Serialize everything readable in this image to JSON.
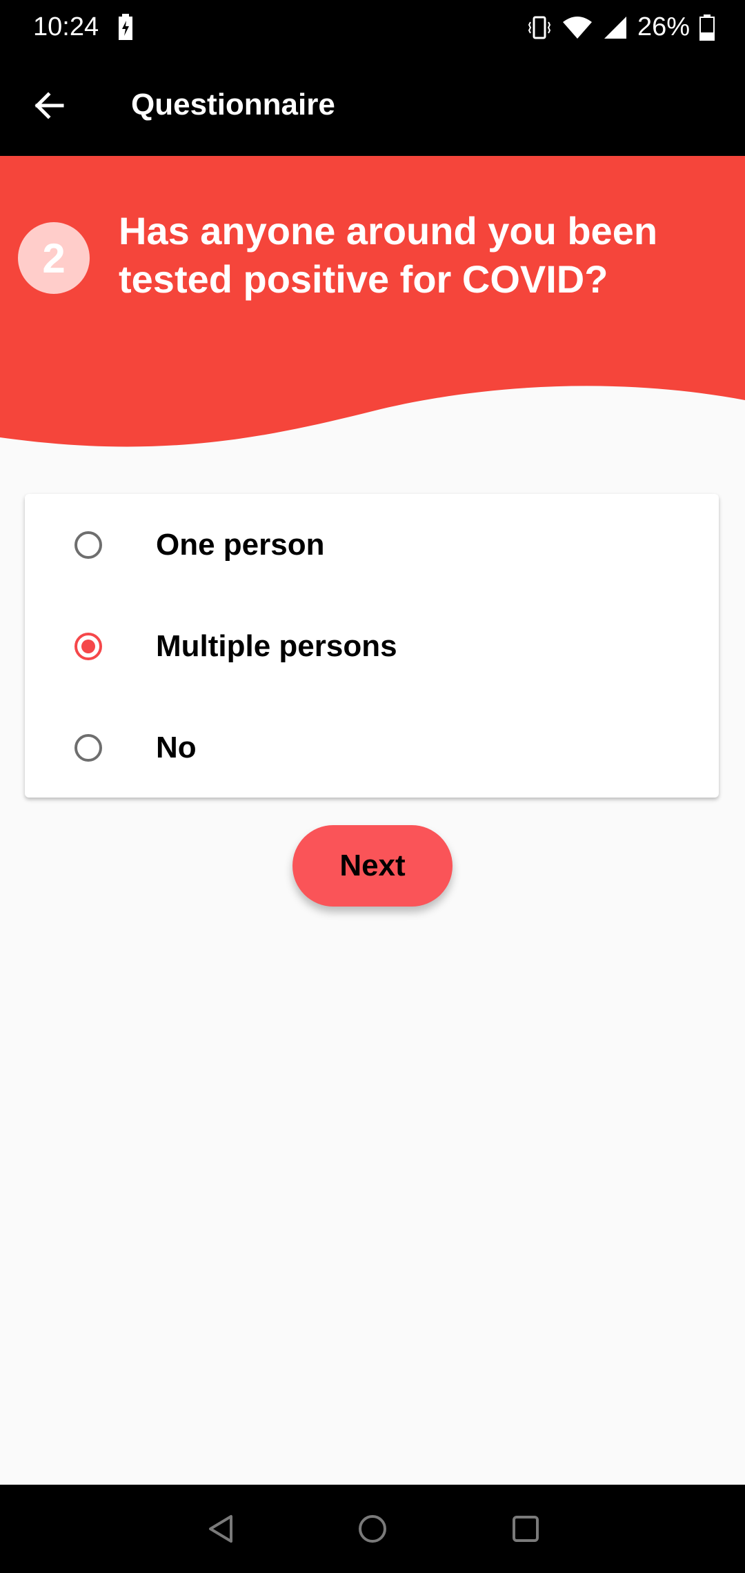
{
  "status_bar": {
    "time": "10:24",
    "battery_percent": "26%",
    "icons": [
      "battery-charging-icon",
      "vibrate-icon",
      "wifi-icon",
      "cell-signal-icon",
      "battery-icon"
    ]
  },
  "app_bar": {
    "title": "Questionnaire",
    "back_icon": "arrow-back-icon"
  },
  "question": {
    "number": "2",
    "text": "Has anyone around you been tested positive for COVID?"
  },
  "options": [
    {
      "label": "One person",
      "selected": false
    },
    {
      "label": "Multiple persons",
      "selected": true
    },
    {
      "label": "No",
      "selected": false
    }
  ],
  "next_label": "Next",
  "colors": {
    "accent": "#f5474a",
    "button": "#fa5458",
    "header": "#f5453b",
    "background": "#fafafa"
  },
  "nav_bar": {
    "icons": [
      "back-triangle-icon",
      "home-circle-icon",
      "recents-square-icon"
    ]
  }
}
